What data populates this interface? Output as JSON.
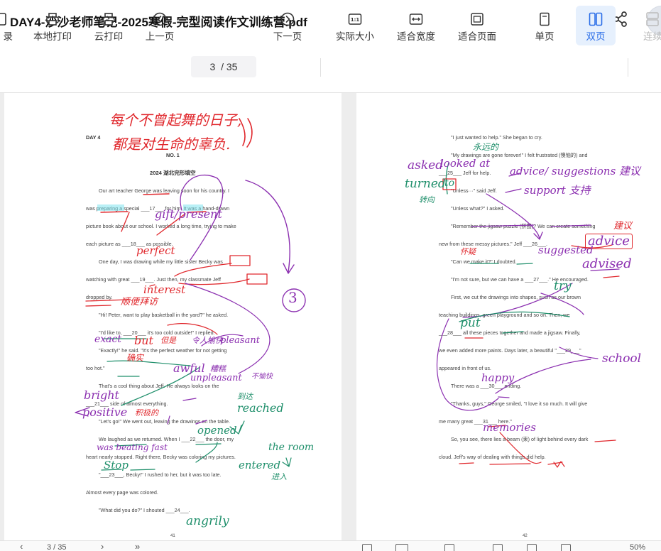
{
  "window": {
    "title": "DAY4-沙沙老师笔记-2025寒假-完型阅读作文训练营.pdf"
  },
  "toolbar": {
    "catalog_label": "录",
    "local_print_label": "本地打印",
    "cloud_print_label": "云打印",
    "prev_label": "上一页",
    "current_page": "3",
    "total_pages": "/ 35",
    "next_label": "下一页",
    "actual_size_label": "实际大小",
    "fit_width_label": "适合宽度",
    "fit_page_label": "适合页面",
    "single_label": "单页",
    "double_label": "双页",
    "continuous_label": "连续"
  },
  "left_page": {
    "day": "DAY 4",
    "no": "NO. 1",
    "heading": "2024 湖北完形填空",
    "lines": [
      "Our art teacher George was leaving soon for his country. I",
      "was preparing a special ___17___ for him. It was a hand-drawn",
      "picture book about our school. I worked a long time, trying to make",
      "each picture as ___18___ as possible.",
      "One day, I was drawing while my little sister Becky was",
      "watching with great ___19___. Just then, my classmate Jeff",
      "dropped by.",
      "\"Hi! Peter, want to play basketball in the yard?\" he asked.",
      "\"I'd like to, ___20___ it's too cold outside!\" I replied.",
      "\"Exactly!\" he said. \"It's the perfect weather for not getting",
      "too hot.\"",
      "That's a cool thing about Jeff. He always looks on the",
      "___21___ side of almost everything.",
      "\"Let's go!\" We went out, leaving the drawings on the table.",
      "We laughed as we returned. When I ___22___ the door, my",
      "heart nearly stopped. Right there, Becky was coloring my pictures.",
      "\"___23___, Becky!\" I rushed to her, but it was too late.",
      "Almost every page was colored.",
      "\"What did you do?\" I shouted ___24___."
    ],
    "page_number": "41"
  },
  "left_annotations": {
    "motto_1": "每个不曾起舞的日子,",
    "motto_2": "都是对生命的辜负.",
    "a17": "gift/present",
    "a18": "perfect",
    "a19": "interest",
    "a_dropped": "顺便拜访",
    "a20_exact": "exact",
    "a20_but": "but",
    "a20_cn": "但是",
    "a_pleasant_cn": "令人愉快",
    "a_pleasant": "pleasant",
    "a_exactly_cn": "确实",
    "a_awful": "awful",
    "a_awful_cn": "糟糕",
    "a_unpleasant": "unpleasant",
    "a_unpleasant_cn": "不愉快",
    "a21_bright": "bright",
    "a21_positive": "positive",
    "a21_cn": "积极的",
    "a_reached_cn": "到达",
    "a_reached": "reached",
    "a22_opened": "opened",
    "a_beating": "was beating fast",
    "a_the_room": "the room",
    "a23_stop": "Stop",
    "a22_entered": "entered",
    "a22_cn": "进入",
    "a24_angrily": "angrily",
    "circle_num": "3"
  },
  "right_page": {
    "lines": [
      "\"I just wanted to help.\" She began to cry.",
      "\"My drawings are gone forever!\" I felt frustrated (懊恼的) and",
      "___25___ Jeff for help.",
      "\"Unless···\" said Jeff.",
      "\"Unless what?\" I asked.",
      "\"Remember the jigsaw puzzle (拼图)? We can create something",
      "new from these messy pictures.\" Jeff ___26___.",
      "\"Can we make it?\" I doubted.",
      "\"I'm not sure, but we can have a ___27___.\" He encouraged.",
      "First, we cut the drawings into shapes, such as our brown",
      "teaching buildings, green playground and so on. Then, we",
      "___28___ all these pieces together and made a jigsaw. Finally,",
      "we even added more paints. Days later, a beautiful \"___29___\"",
      "appeared in front of us.",
      "There was a ___30___ ending.",
      "\"Thanks, guys,\" George smiled, \"I love it so much. It will give",
      "me many great ___31___ here.\"",
      "So, you see, there lies a beam (束) of light behind every dark",
      "cloud. Jeff's way of dealing with things did help."
    ],
    "page_number": "42"
  },
  "right_annotations": {
    "a_forever_cn": "永远的",
    "a25_asked": "asked",
    "a25_looked": "looked at",
    "a25_turned": "turned",
    "a25_to": "to",
    "a25_cn": "转向",
    "a_advice_list": "advice/ suggestions 建议",
    "a_support": "support 支持",
    "a_suggest_cn": "建议",
    "a26_advice": "advice",
    "a26_suggested": "suggested",
    "a26_advised": "advised",
    "a_doubt_cn": "怀疑",
    "a27_try": "try",
    "a28_put": "put",
    "a29_school": "school",
    "a30_happy": "happy",
    "a31_memories": "memories"
  },
  "bottom_bar": {
    "page_indicator": "3 / 35",
    "zoom": "50%"
  },
  "colors": {
    "accent": "#2b6ee8",
    "ink_red": "#e0282d",
    "ink_purple": "#8b2fb0",
    "ink_green": "#1f8f6b",
    "highlight": "#7fe3ee"
  }
}
